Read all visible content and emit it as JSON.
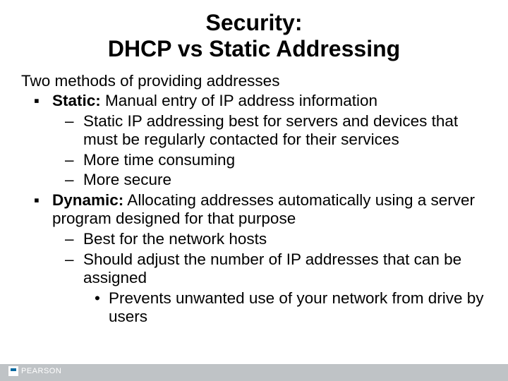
{
  "title_line1": "Security:",
  "title_line2": "DHCP vs Static Addressing",
  "intro": "Two methods of providing addresses",
  "items": [
    {
      "label": "Static:",
      "rest": " Manual entry of IP address information",
      "subs": [
        "Static IP addressing best for servers and devices that must be regularly contacted for their services",
        "More time consuming",
        "More secure"
      ]
    },
    {
      "label": "Dynamic:",
      "rest": " Allocating addresses automatically using a server program designed for that purpose",
      "subs": [
        "Best for the network hosts",
        "Should adjust the number of IP addresses that can be assigned"
      ],
      "subsubs": [
        "Prevents unwanted use of your network from drive by users"
      ]
    }
  ],
  "footer_brand": "PEARSON"
}
